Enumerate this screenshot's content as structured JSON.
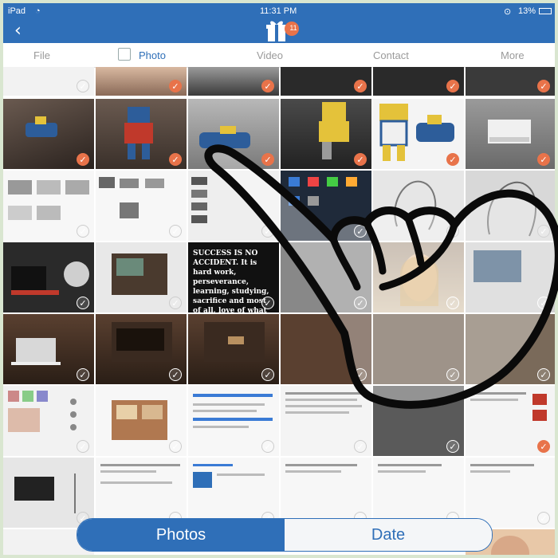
{
  "status": {
    "carrier": "iPad",
    "time": "11:31 PM",
    "battery": "13%"
  },
  "nav": {
    "back_glyph": "‹",
    "badge": "11"
  },
  "tabs": [
    {
      "label": "File"
    },
    {
      "label": "Photo"
    },
    {
      "label": "Video"
    },
    {
      "label": "Contact"
    },
    {
      "label": "More"
    }
  ],
  "tile_text": {
    "quote": "SUCCESS IS NO ACCIDENT. It is hard work, perseverance, learning, studying, sacrifice and most of all, love of what you are doing or learning to do. - Pele"
  },
  "bottom": {
    "photos_label": "Photos",
    "date_label": "Date"
  },
  "colors": {
    "accent": "#2f6fb8",
    "check": "#e8734a"
  }
}
